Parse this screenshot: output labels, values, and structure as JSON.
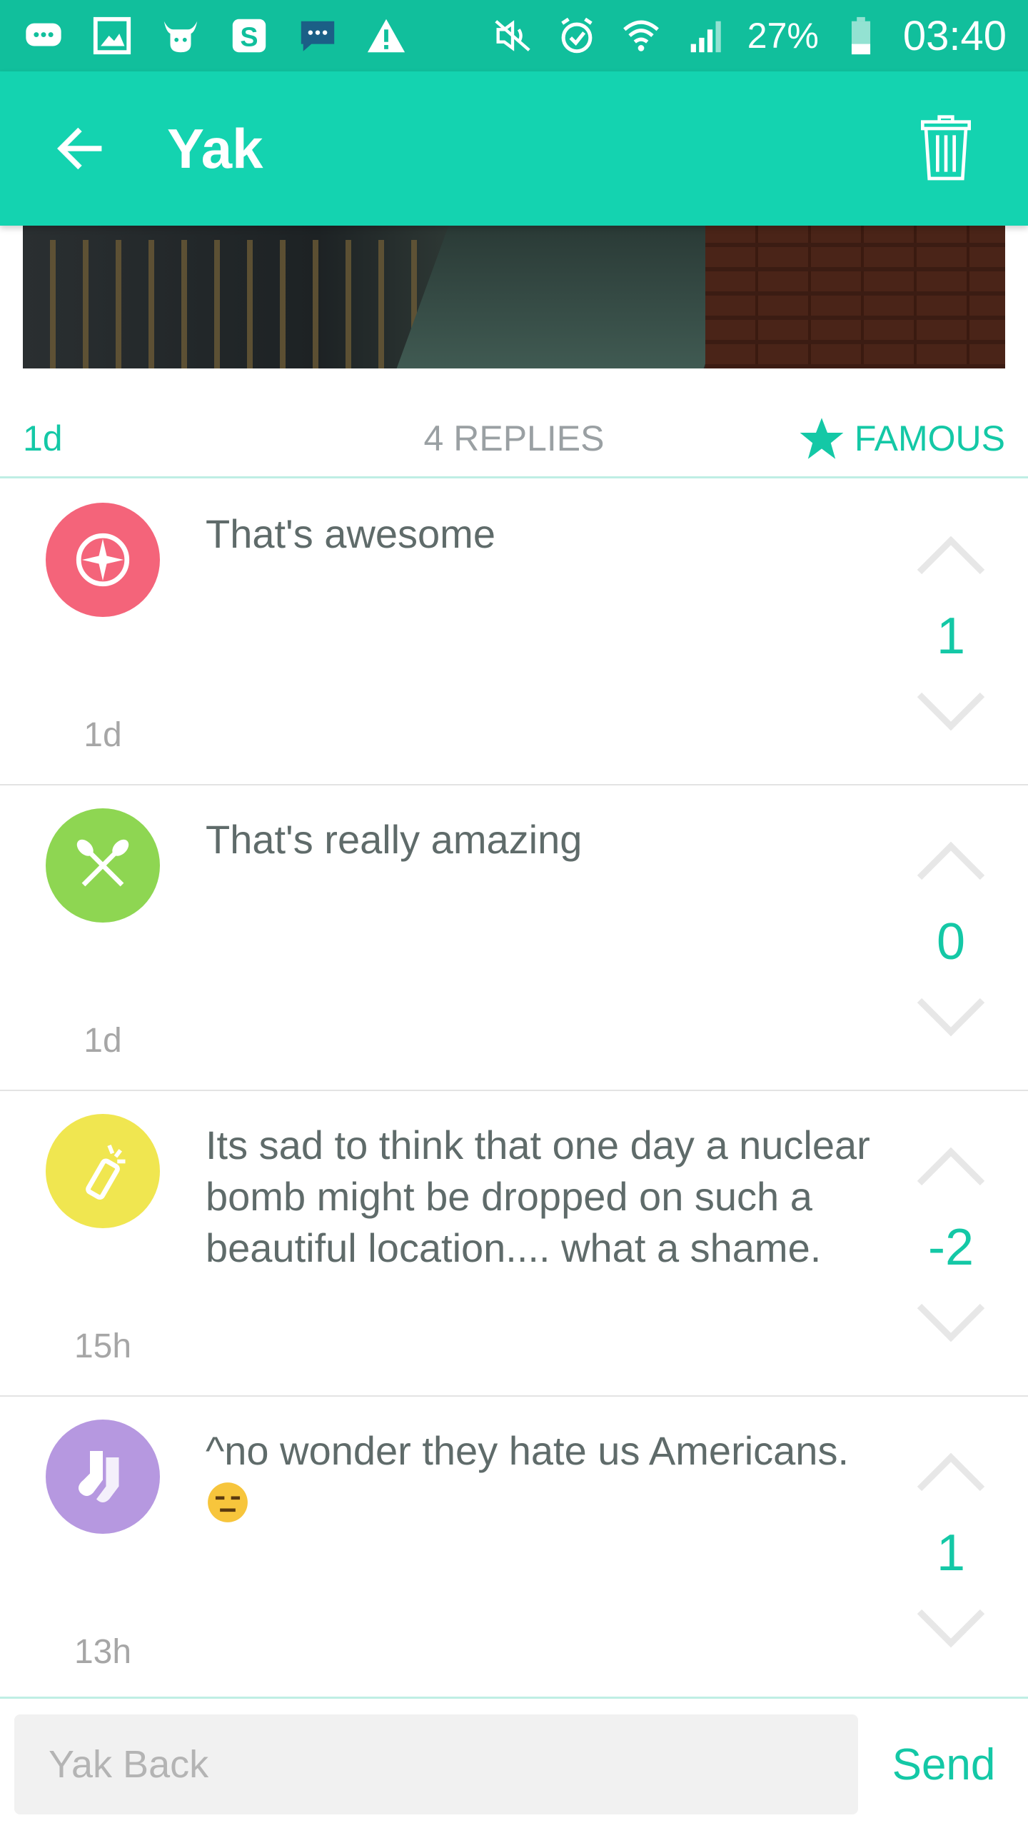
{
  "status_bar": {
    "icons": [
      "chat-bubble-icon",
      "image-icon",
      "yak-icon",
      "skype-icon",
      "message-icon",
      "warning-icon",
      "mute-icon",
      "alarm-icon",
      "wifi-icon",
      "signal-icon",
      "battery-icon"
    ],
    "battery": "27%",
    "time": "03:40"
  },
  "app_bar": {
    "title": "Yak",
    "icons": [
      "back-arrow-icon",
      "trash-icon"
    ]
  },
  "post_meta": {
    "age": "1d",
    "replies": "4 REPLIES",
    "famous_label": "FAMOUS"
  },
  "replies": [
    {
      "text": "That's awesome",
      "time": "1d",
      "votes": "1",
      "avatar_color": "#f4647a",
      "avatar_icon": "compass-icon"
    },
    {
      "text": "That's really amazing",
      "time": "1d",
      "votes": "0",
      "avatar_color": "#8ed652",
      "avatar_icon": "crossed-paddles-icon"
    },
    {
      "text": "Its sad to think that one day a nuclear bomb might be dropped on such a beautiful location.... what a shame.",
      "time": "15h",
      "votes": "-2",
      "avatar_color": "#f0e650",
      "avatar_icon": "flashlight-icon"
    },
    {
      "text": " ^no wonder they hate us Americans.",
      "time": "13h",
      "votes": "1",
      "avatar_color": "#b698e0",
      "avatar_icon": "socks-icon",
      "emoji": "expressionless-face-emoji"
    }
  ],
  "compose": {
    "placeholder": "Yak Back",
    "send_label": "Send"
  },
  "colors": {
    "status_bar": "#11bf9c",
    "app_bar": "#14d3b0",
    "accent": "#14c8a6",
    "divider": "#bfeee4"
  }
}
